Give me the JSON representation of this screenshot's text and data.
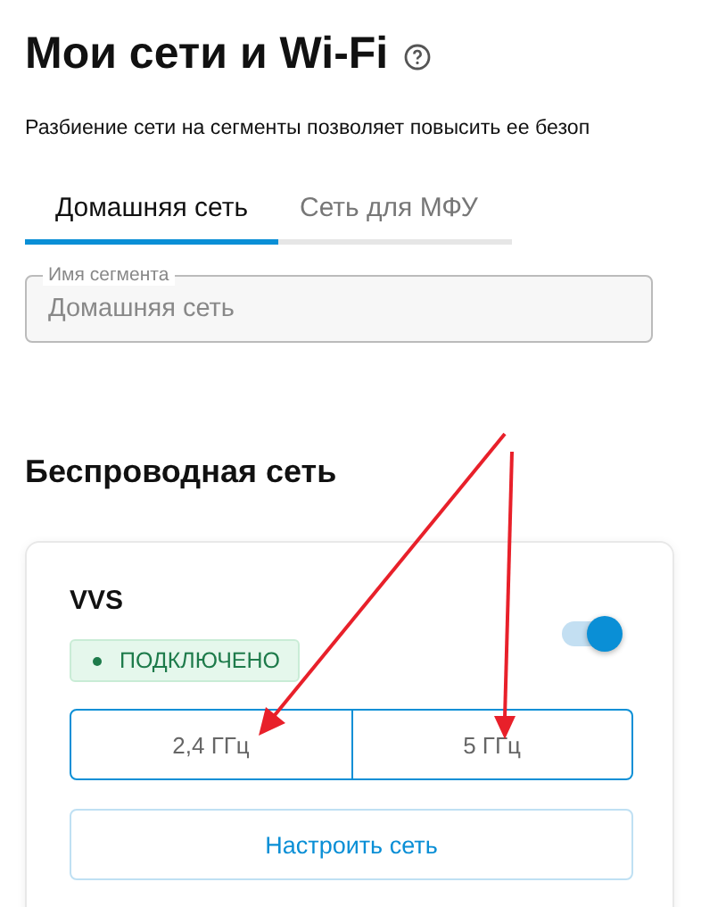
{
  "page": {
    "title": "Мои сети и Wi-Fi",
    "description": "Разбиение сети на сегменты позволяет повысить ее безоп"
  },
  "tabs": [
    {
      "label": "Домашняя сеть",
      "selected": true
    },
    {
      "label": "Сеть для МФУ",
      "selected": false
    }
  ],
  "segment_name": {
    "label": "Имя сегмента",
    "value": "Домашняя сеть"
  },
  "wireless": {
    "heading": "Беспроводная сеть",
    "network": {
      "name": "VVS",
      "on": true,
      "status": {
        "label": "ПОДКЛЮЧЕНО",
        "color": "#1e7b4b"
      },
      "bands": [
        "2,4 ГГц",
        "5 ГГц"
      ],
      "configure_button": "Настроить сеть"
    }
  }
}
